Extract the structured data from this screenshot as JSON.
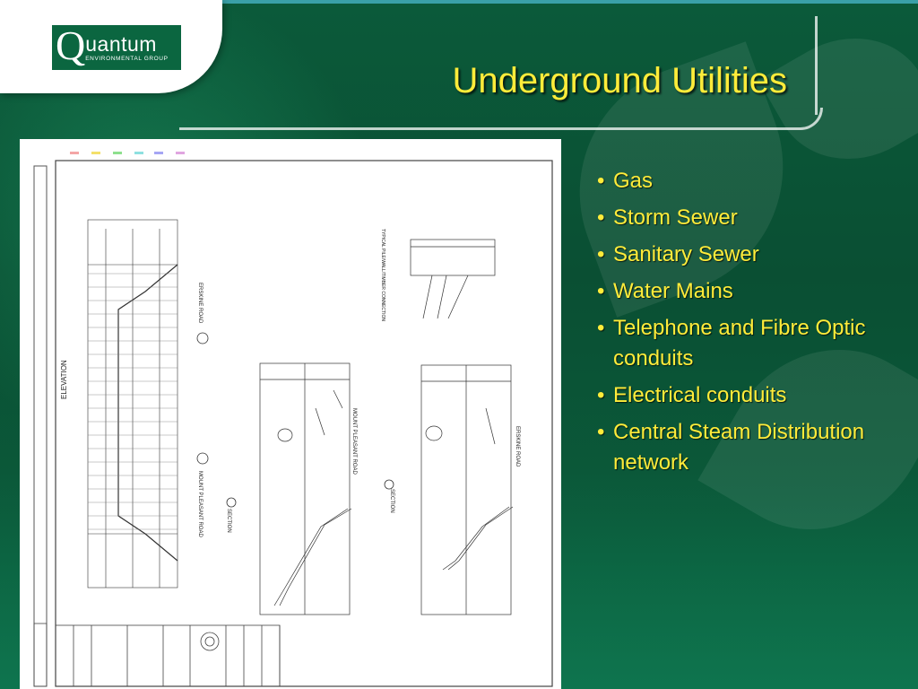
{
  "slide": {
    "title": "Underground Utilities",
    "logo": {
      "mark": "Q",
      "name": "uantum",
      "subtitle": "ENVIRONMENTAL GROUP"
    },
    "bullets": [
      "Gas",
      "Storm Sewer",
      "Sanitary Sewer",
      "Water Mains",
      "Telephone and Fibre Optic conduits",
      "Electrical conduits",
      "Central Steam Distribution network"
    ],
    "drawing": {
      "labels": {
        "elevation": "ELEVATION",
        "erskine_road": "ERSKINE ROAD",
        "mount_pleasant_road": "MOUNT PLEASANT ROAD",
        "section": "SECTION",
        "typical": "TYPICAL PILE/WALL/TIMBER CONNECTION"
      }
    }
  },
  "colors": {
    "title": "#ffec3a",
    "bullets": "#ffec3a",
    "background": "#0b5a3a",
    "logo_green": "#0b6640"
  }
}
